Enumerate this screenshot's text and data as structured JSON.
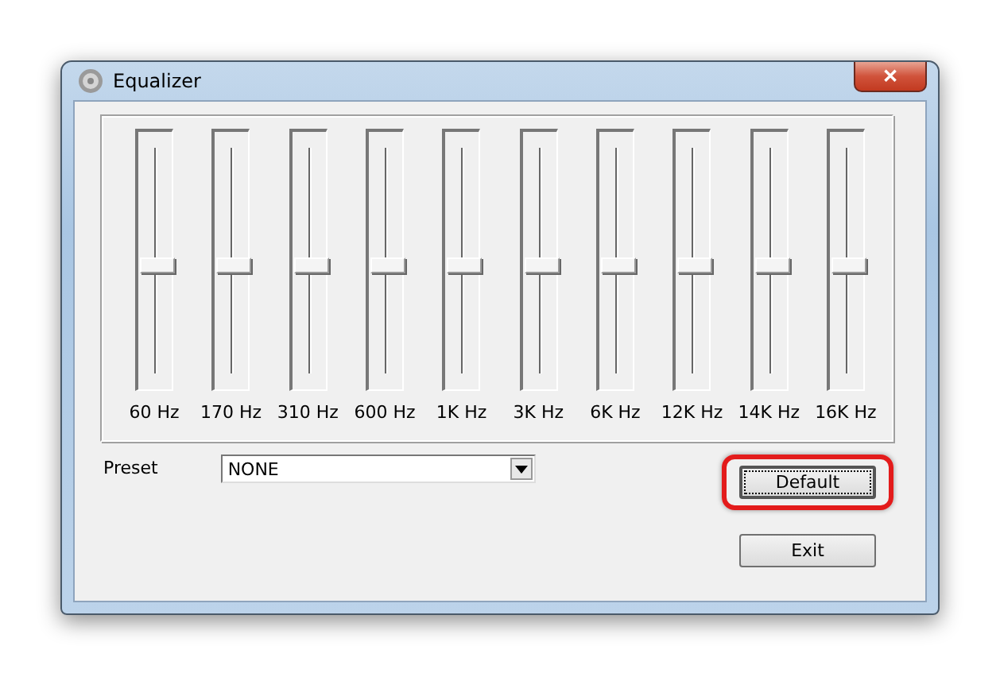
{
  "window": {
    "title": "Equalizer",
    "close": "✕"
  },
  "bands": [
    {
      "label": "60 Hz",
      "level": 0.5
    },
    {
      "label": "170 Hz",
      "level": 0.5
    },
    {
      "label": "310 Hz",
      "level": 0.5
    },
    {
      "label": "600 Hz",
      "level": 0.5
    },
    {
      "label": "1K Hz",
      "level": 0.5
    },
    {
      "label": "3K Hz",
      "level": 0.5
    },
    {
      "label": "6K Hz",
      "level": 0.5
    },
    {
      "label": "12K Hz",
      "level": 0.5
    },
    {
      "label": "14K Hz",
      "level": 0.5
    },
    {
      "label": "16K Hz",
      "level": 0.5
    }
  ],
  "preset": {
    "label": "Preset",
    "value": "NONE"
  },
  "buttons": [
    {
      "label": "Default",
      "highlighted": true
    },
    {
      "label": "Exit",
      "highlighted": false
    }
  ]
}
